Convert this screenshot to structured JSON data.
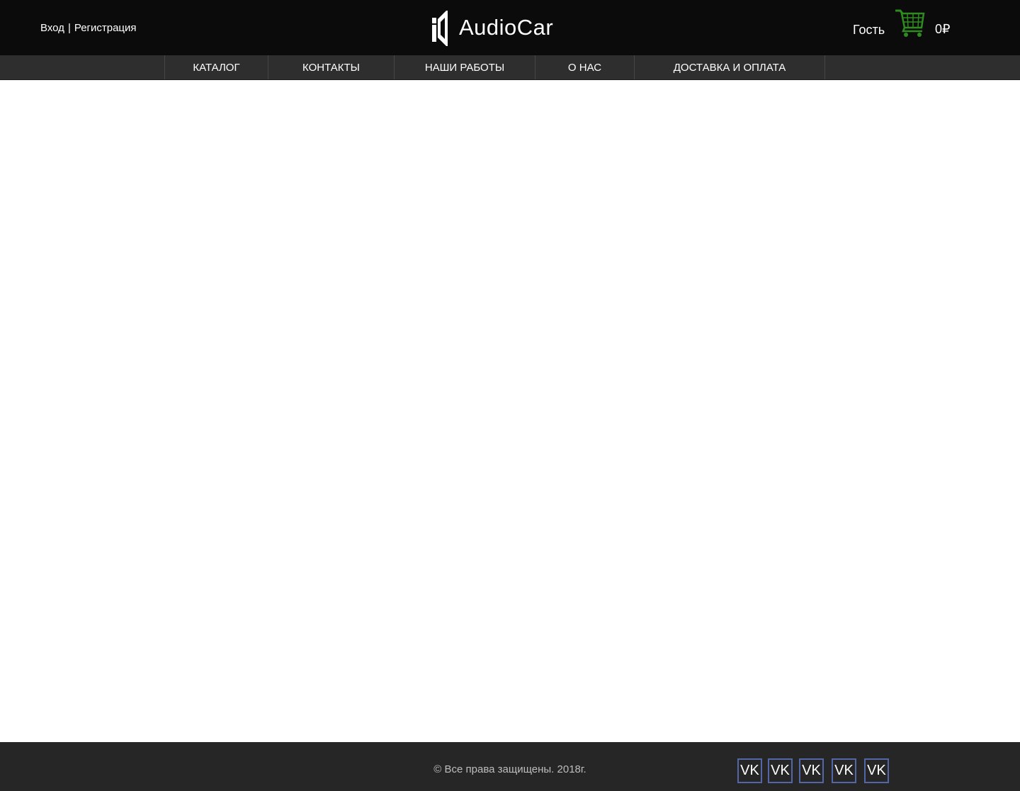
{
  "header": {
    "login_label": "Вход",
    "separator": "|",
    "register_label": "Регистрация",
    "logo_text": "AudioCar",
    "user_label": "Гость",
    "cart_total": "0₽"
  },
  "nav": {
    "items": [
      {
        "label": "КАТАЛОГ"
      },
      {
        "label": "КОНТАКТЫ"
      },
      {
        "label": "НАШИ РАБОТЫ"
      },
      {
        "label": "О НАС"
      },
      {
        "label": "ДОСТАВКА И ОПЛАТА"
      }
    ]
  },
  "footer": {
    "copyright": "© Все права защищены. 2018г.",
    "social_links": [
      {
        "label": "VK"
      },
      {
        "label": "VK"
      },
      {
        "label": "VK"
      },
      {
        "label": "VK"
      },
      {
        "label": "VK"
      }
    ]
  },
  "colors": {
    "header_bg": "#0b0b0b",
    "nav_bg": "#2e2e2e",
    "footer_bg": "#262626",
    "cart_green": "#2e8b1f",
    "social_border": "#5566a6"
  },
  "icons": {
    "logo": "speaker-logo-icon",
    "cart": "shopping-cart-icon"
  }
}
